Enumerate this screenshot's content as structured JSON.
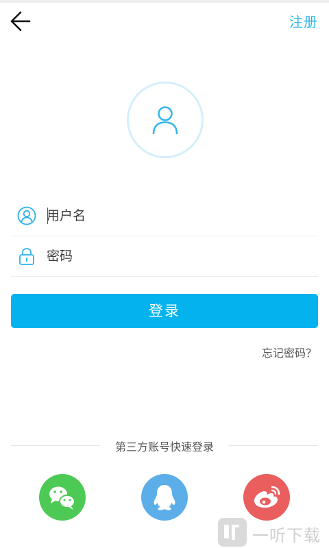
{
  "header": {
    "back_icon": "arrow-left-icon",
    "register_label": "注册"
  },
  "avatar": {
    "icon": "user-icon"
  },
  "form": {
    "username": {
      "icon": "user-circle-icon",
      "placeholder": "用户名",
      "value": ""
    },
    "password": {
      "icon": "lock-icon",
      "placeholder": "密码",
      "value": ""
    },
    "login_label": "登录",
    "forgot_label": "忘记密码？"
  },
  "third_party": {
    "label": "第三方账号快速登录",
    "providers": [
      {
        "icon": "wechat-icon",
        "color": "#4dca56"
      },
      {
        "icon": "qq-icon",
        "color": "#5baee8"
      },
      {
        "icon": "weibo-icon",
        "color": "#ea5e5e"
      }
    ]
  },
  "watermark": {
    "text": "一听下载"
  },
  "colors": {
    "accent": "#04b3ee",
    "register": "#27b4ea",
    "icon_stroke": "#29b2ea"
  }
}
